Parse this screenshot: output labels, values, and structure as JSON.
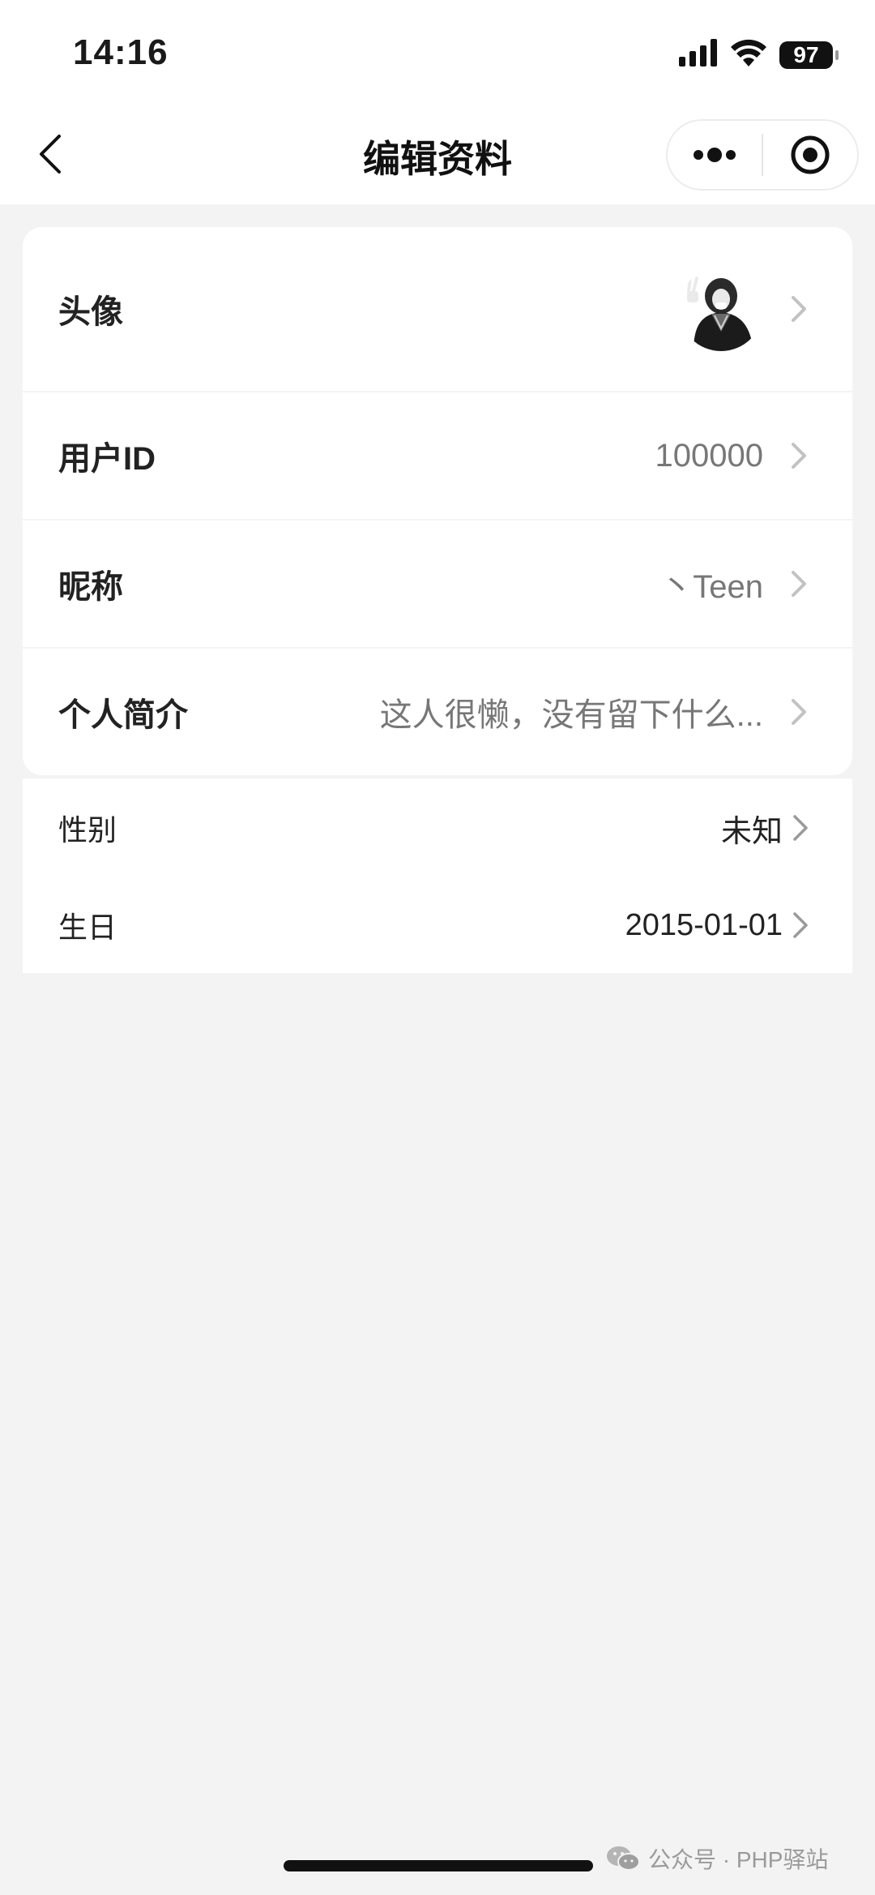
{
  "status_bar": {
    "time": "14:16",
    "battery": "97",
    "icons": [
      "signal-icon",
      "wifi-icon",
      "battery-icon"
    ]
  },
  "nav": {
    "title": "编辑资料",
    "back_icon": "back-chevron-icon",
    "capsule_icons": [
      "more-dots-icon",
      "close-target-icon"
    ]
  },
  "profile": {
    "rows": [
      {
        "label": "头像",
        "value": ""
      },
      {
        "label": "用户ID",
        "value": "100000"
      },
      {
        "label": "昵称",
        "value": "丶Teen"
      },
      {
        "label": "个人简介",
        "value": "这人很懒，没有留下什么..."
      }
    ],
    "extra_rows": [
      {
        "label": "性别",
        "value": "未知"
      },
      {
        "label": "生日",
        "value": "2015-01-01"
      }
    ]
  },
  "watermark": {
    "text": "公众号 · PHP驿站"
  },
  "colors": {
    "background": "#f3f3f3",
    "card": "#ffffff",
    "value_text": "#777777",
    "chevron": "#c2c2c2"
  }
}
